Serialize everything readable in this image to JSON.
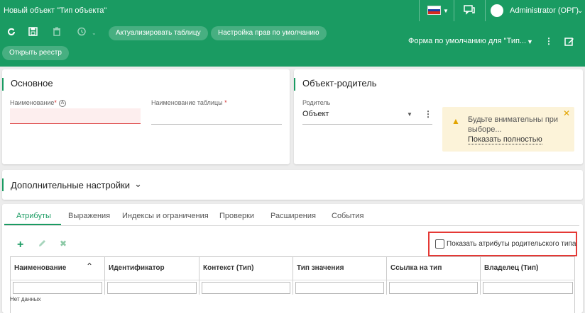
{
  "window": {
    "title": "Новый объект \"Тип объекта\""
  },
  "user": {
    "name": "Administrator (ОРГ)"
  },
  "toolbar": {
    "refresh_label": "Актуализировать таблицу",
    "rights_label": "Настройка прав по умолчанию",
    "registry_label": "Открыть реестр",
    "form_select": "Форма по умолчанию для \"Тип..."
  },
  "main": {
    "title": "Основное",
    "name_label": "Наименование",
    "table_name_label": "Наименование таблицы",
    "req_mark": "*",
    "a_mark": "A"
  },
  "parent": {
    "title": "Объект-родитель",
    "label": "Родитель",
    "value": "Объект",
    "warning_text": "Будьте внимательны при выборе...",
    "warning_link": "Показать полностью"
  },
  "additional": {
    "title": "Дополнительные настройки"
  },
  "tabs": [
    "Атрибуты",
    "Выражения",
    "Индексы и ограничения",
    "Проверки",
    "Расширения",
    "События"
  ],
  "attributes": {
    "show_parent_label": "Показать атрибуты родительского типа",
    "columns": [
      "Наименование",
      "Идентификатор",
      "Контекст (Тип)",
      "Тип значения",
      "Ссылка на тип",
      "Владелец (Тип)"
    ],
    "empty_text": "Нет данных"
  },
  "colors": {
    "brand": "#1a9b62",
    "warning": "#fcf3d9",
    "highlight": "#e53935"
  }
}
